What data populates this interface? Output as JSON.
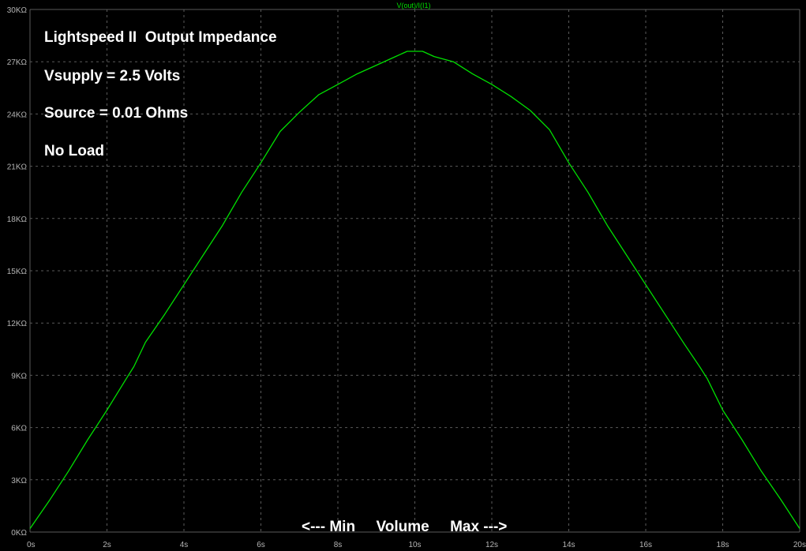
{
  "chart_data": {
    "type": "line",
    "title": "V(out)/I(I1)",
    "xlabel": "",
    "ylabel": "",
    "xlim": [
      0,
      20
    ],
    "ylim": [
      0,
      30
    ],
    "x_unit": "s",
    "y_unit": "KΩ",
    "grid": true,
    "x_ticks": [
      "0s",
      "2s",
      "4s",
      "6s",
      "8s",
      "10s",
      "12s",
      "14s",
      "16s",
      "18s",
      "20s"
    ],
    "x_tick_values": [
      0,
      2,
      4,
      6,
      8,
      10,
      12,
      14,
      16,
      18,
      20
    ],
    "y_ticks": [
      "0KΩ",
      "3KΩ",
      "6KΩ",
      "9KΩ",
      "12KΩ",
      "15KΩ",
      "18KΩ",
      "21KΩ",
      "24KΩ",
      "27KΩ",
      "30KΩ"
    ],
    "y_tick_values": [
      0,
      3,
      6,
      9,
      12,
      15,
      18,
      21,
      24,
      27,
      30
    ],
    "series": [
      {
        "name": "V(out)/I(I1)",
        "color": "#00e000",
        "x": [
          0,
          0.5,
          1,
          1.5,
          2,
          2.5,
          2.7,
          3,
          3.5,
          4,
          4.5,
          5,
          5.5,
          6,
          6.5,
          7,
          7.5,
          8,
          8.5,
          9,
          9.5,
          9.8,
          10.2,
          10.5,
          11,
          11.5,
          12,
          12.5,
          13,
          13.5,
          14,
          14.5,
          15,
          15.5,
          16,
          16.5,
          17,
          17.4,
          17.6,
          18,
          18.5,
          19,
          19.5,
          20
        ],
        "y": [
          0.2,
          1.8,
          3.5,
          5.3,
          7.0,
          8.8,
          9.5,
          10.9,
          12.5,
          14.2,
          15.9,
          17.6,
          19.5,
          21.2,
          23.0,
          24.1,
          25.1,
          25.7,
          26.3,
          26.8,
          27.3,
          27.6,
          27.6,
          27.3,
          27.0,
          26.3,
          25.7,
          25.0,
          24.2,
          23.1,
          21.2,
          19.5,
          17.6,
          15.9,
          14.2,
          12.5,
          10.8,
          9.5,
          8.8,
          7.0,
          5.3,
          3.5,
          1.9,
          0.2
        ]
      }
    ],
    "annotations": [
      "Lightspeed II  Output Impedance",
      "Vsupply = 2.5 Volts",
      "Source = 0.01 Ohms",
      "No Load",
      "<--- Min     Volume     Max --->"
    ]
  },
  "colors": {
    "background": "#000000",
    "grid": "#5a5a5a",
    "trace": "#00e000",
    "tick_text": "#b4b4b4",
    "annotation_text": "#ffffff"
  }
}
